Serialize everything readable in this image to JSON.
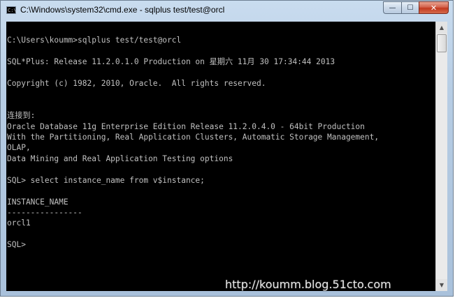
{
  "window": {
    "title": "C:\\Windows\\system32\\cmd.exe - sqlplus  test/test@orcl",
    "app_icon_text": "C:\\",
    "minimize_glyph": "—",
    "maximize_glyph": "☐",
    "close_glyph": "✕"
  },
  "console": {
    "lines": [
      "",
      "C:\\Users\\koumm>sqlplus test/test@orcl",
      "",
      "SQL*Plus: Release 11.2.0.1.0 Production on 星期六 11月 30 17:34:44 2013",
      "",
      "Copyright (c) 1982, 2010, Oracle.  All rights reserved.",
      "",
      "",
      "连接到:",
      "Oracle Database 11g Enterprise Edition Release 11.2.0.4.0 - 64bit Production",
      "With the Partitioning, Real Application Clusters, Automatic Storage Management,",
      "OLAP,",
      "Data Mining and Real Application Testing options",
      "",
      "SQL> select instance_name from v$instance;",
      "",
      "INSTANCE_NAME",
      "----------------",
      "orcl1",
      "",
      "SQL>"
    ]
  },
  "scrollbar": {
    "up_glyph": "▲",
    "down_glyph": "▼"
  },
  "watermark": {
    "text": "http://koumm.blog.51cto.com"
  }
}
